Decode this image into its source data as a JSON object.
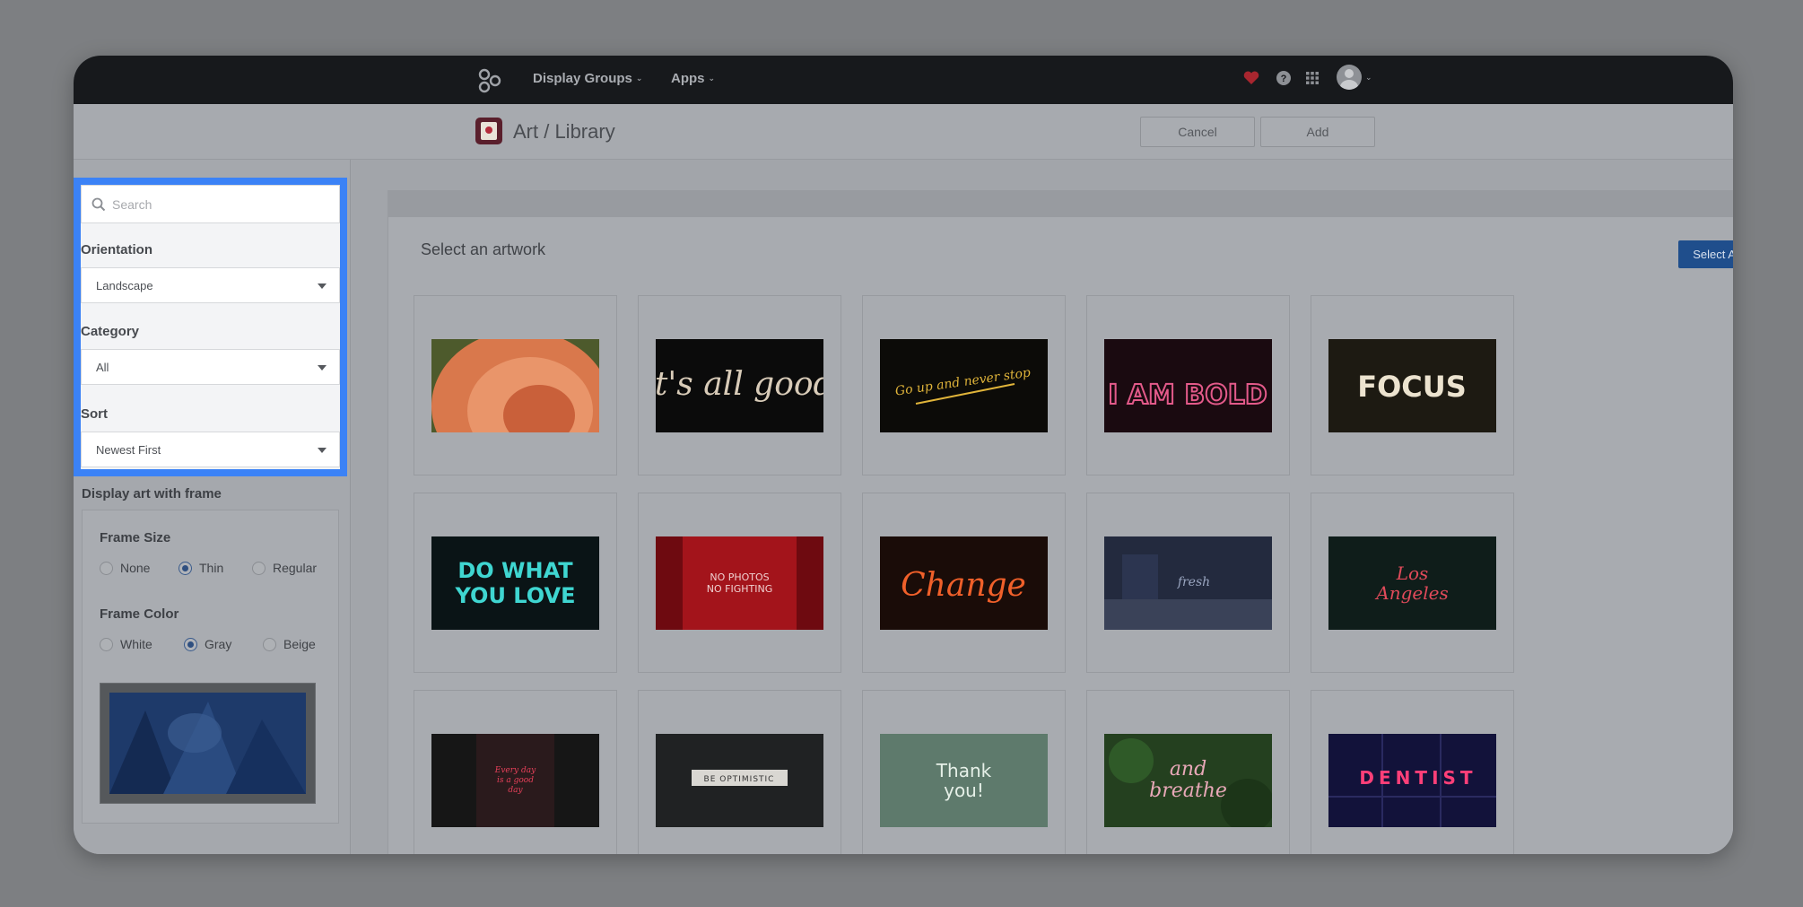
{
  "topbar": {
    "nav": [
      {
        "label": "Display Groups"
      },
      {
        "label": "Apps"
      }
    ],
    "icons": [
      "heart-icon",
      "help-icon",
      "apps-grid-icon",
      "avatar"
    ]
  },
  "header": {
    "title": "Art / Library",
    "cancel_label": "Cancel",
    "add_label": "Add"
  },
  "sidebar": {
    "search": {
      "placeholder": "Search",
      "value": ""
    },
    "orientation": {
      "label": "Orientation",
      "value": "Landscape"
    },
    "category": {
      "label": "Category",
      "value": "All"
    },
    "sort": {
      "label": "Sort",
      "value": "Newest First"
    },
    "frame": {
      "heading": "Display art with frame",
      "size_label": "Frame Size",
      "size_options": [
        "None",
        "Thin",
        "Regular"
      ],
      "size_selected": "Thin",
      "color_label": "Frame Color",
      "color_options": [
        "White",
        "Gray",
        "Beige"
      ],
      "color_selected": "Gray"
    }
  },
  "main": {
    "title": "Select an artwork",
    "select_all_label": "Select All",
    "artworks": [
      {
        "text": ""
      },
      {
        "text": "it's all good"
      },
      {
        "text": "Go up and never stop"
      },
      {
        "text": "I AM BOLD"
      },
      {
        "text": "FOCUS"
      },
      {
        "text": "DO WHAT YOU LOVE"
      },
      {
        "text": "NO PHOTOS NO FIGHTING"
      },
      {
        "text": "Change"
      },
      {
        "text": "fresh"
      },
      {
        "text": "Los Angeles"
      },
      {
        "text": "Every day is a good day"
      },
      {
        "text": "BE OPTIMISTIC"
      },
      {
        "text": "Thank you!"
      },
      {
        "text": "and breathe"
      },
      {
        "text": "DENTIST"
      }
    ]
  },
  "colors": {
    "highlight": "#3b82f6",
    "select_all": "#1f4e8c",
    "topbar": "#17191c"
  }
}
